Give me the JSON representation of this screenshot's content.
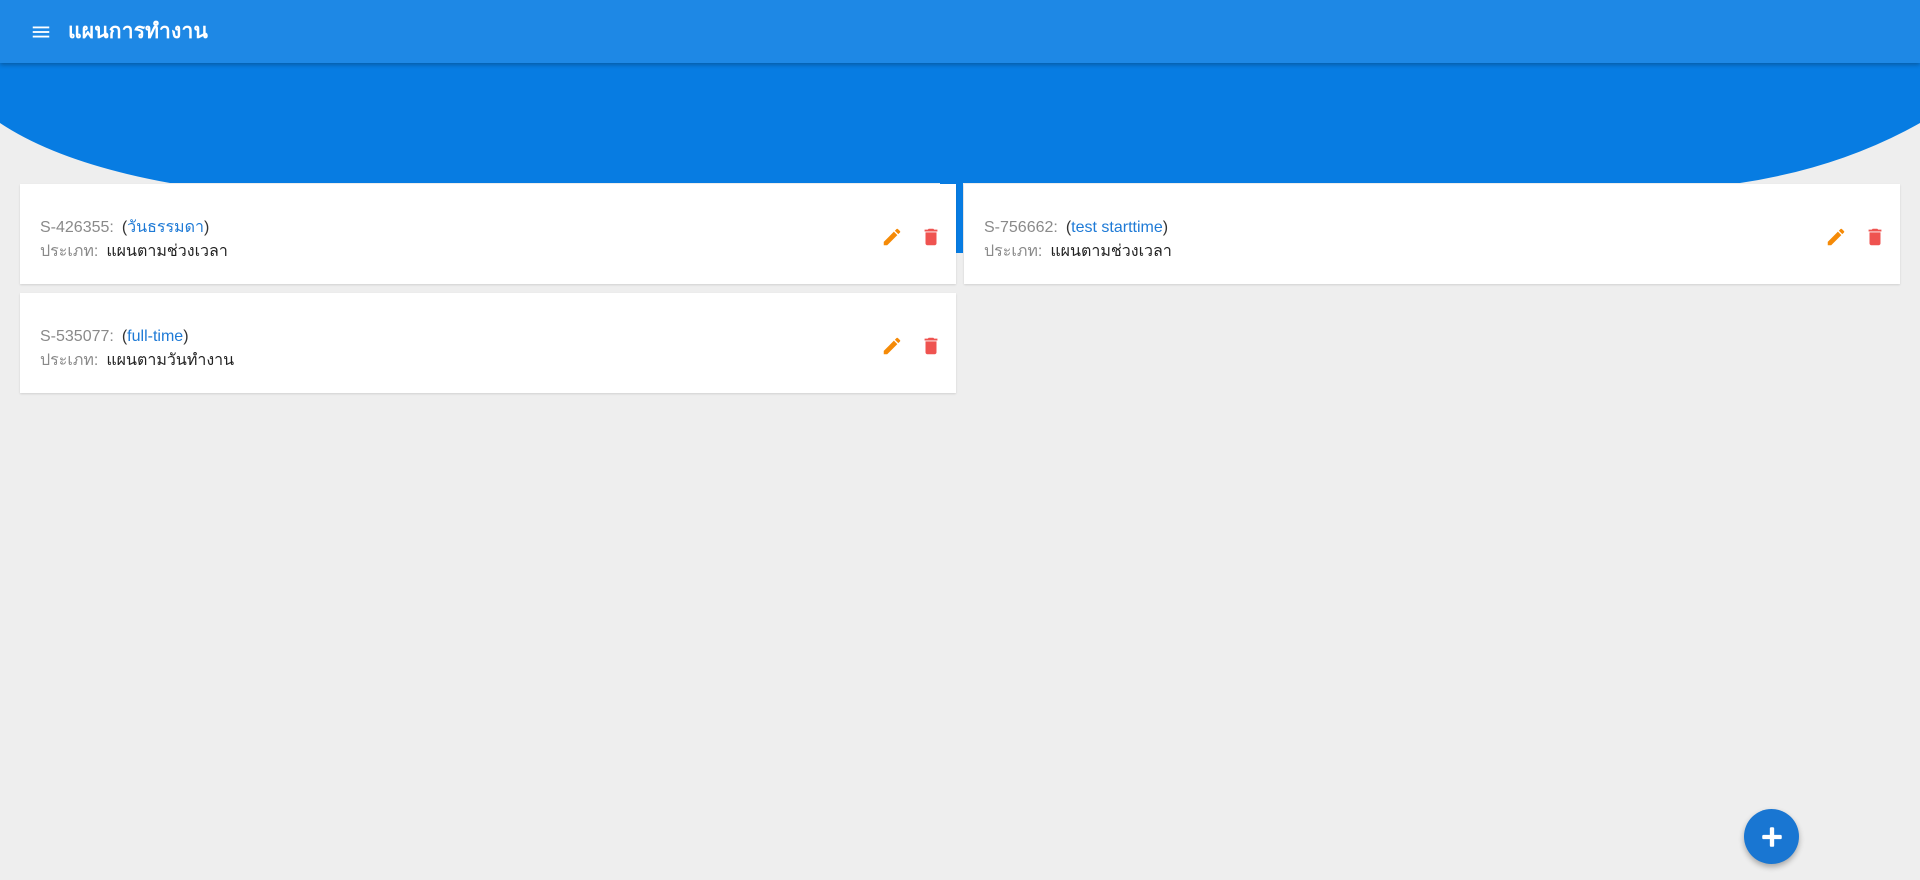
{
  "app": {
    "title": "แผนการทำงาน",
    "menu_icon": "menu-icon",
    "primary_color": "#1e88e5",
    "hero_color": "#077ce2",
    "background_color": "#eeeeee"
  },
  "plans": [
    {
      "code": "S-426355:",
      "name": "วันธรรมดา",
      "type_label": "ประเภท:",
      "type_value": "แผนตามช่วงเวลา",
      "edit_icon": "pencil-icon",
      "delete_icon": "trash-icon"
    },
    {
      "code": "S-756662:",
      "name": "test starttime",
      "type_label": "ประเภท:",
      "type_value": "แผนตามช่วงเวลา",
      "edit_icon": "pencil-icon",
      "delete_icon": "trash-icon"
    },
    {
      "code": "S-535077:",
      "name": "full-time",
      "type_label": "ประเภท:",
      "type_value": "แผนตามวันทำงาน",
      "edit_icon": "pencil-icon",
      "delete_icon": "trash-icon"
    }
  ],
  "colors": {
    "edit": "#f58a07",
    "delete": "#ef5350",
    "link": "#1e7ad6"
  },
  "fab": {
    "icon": "plus-icon",
    "color": "#1976d2"
  }
}
